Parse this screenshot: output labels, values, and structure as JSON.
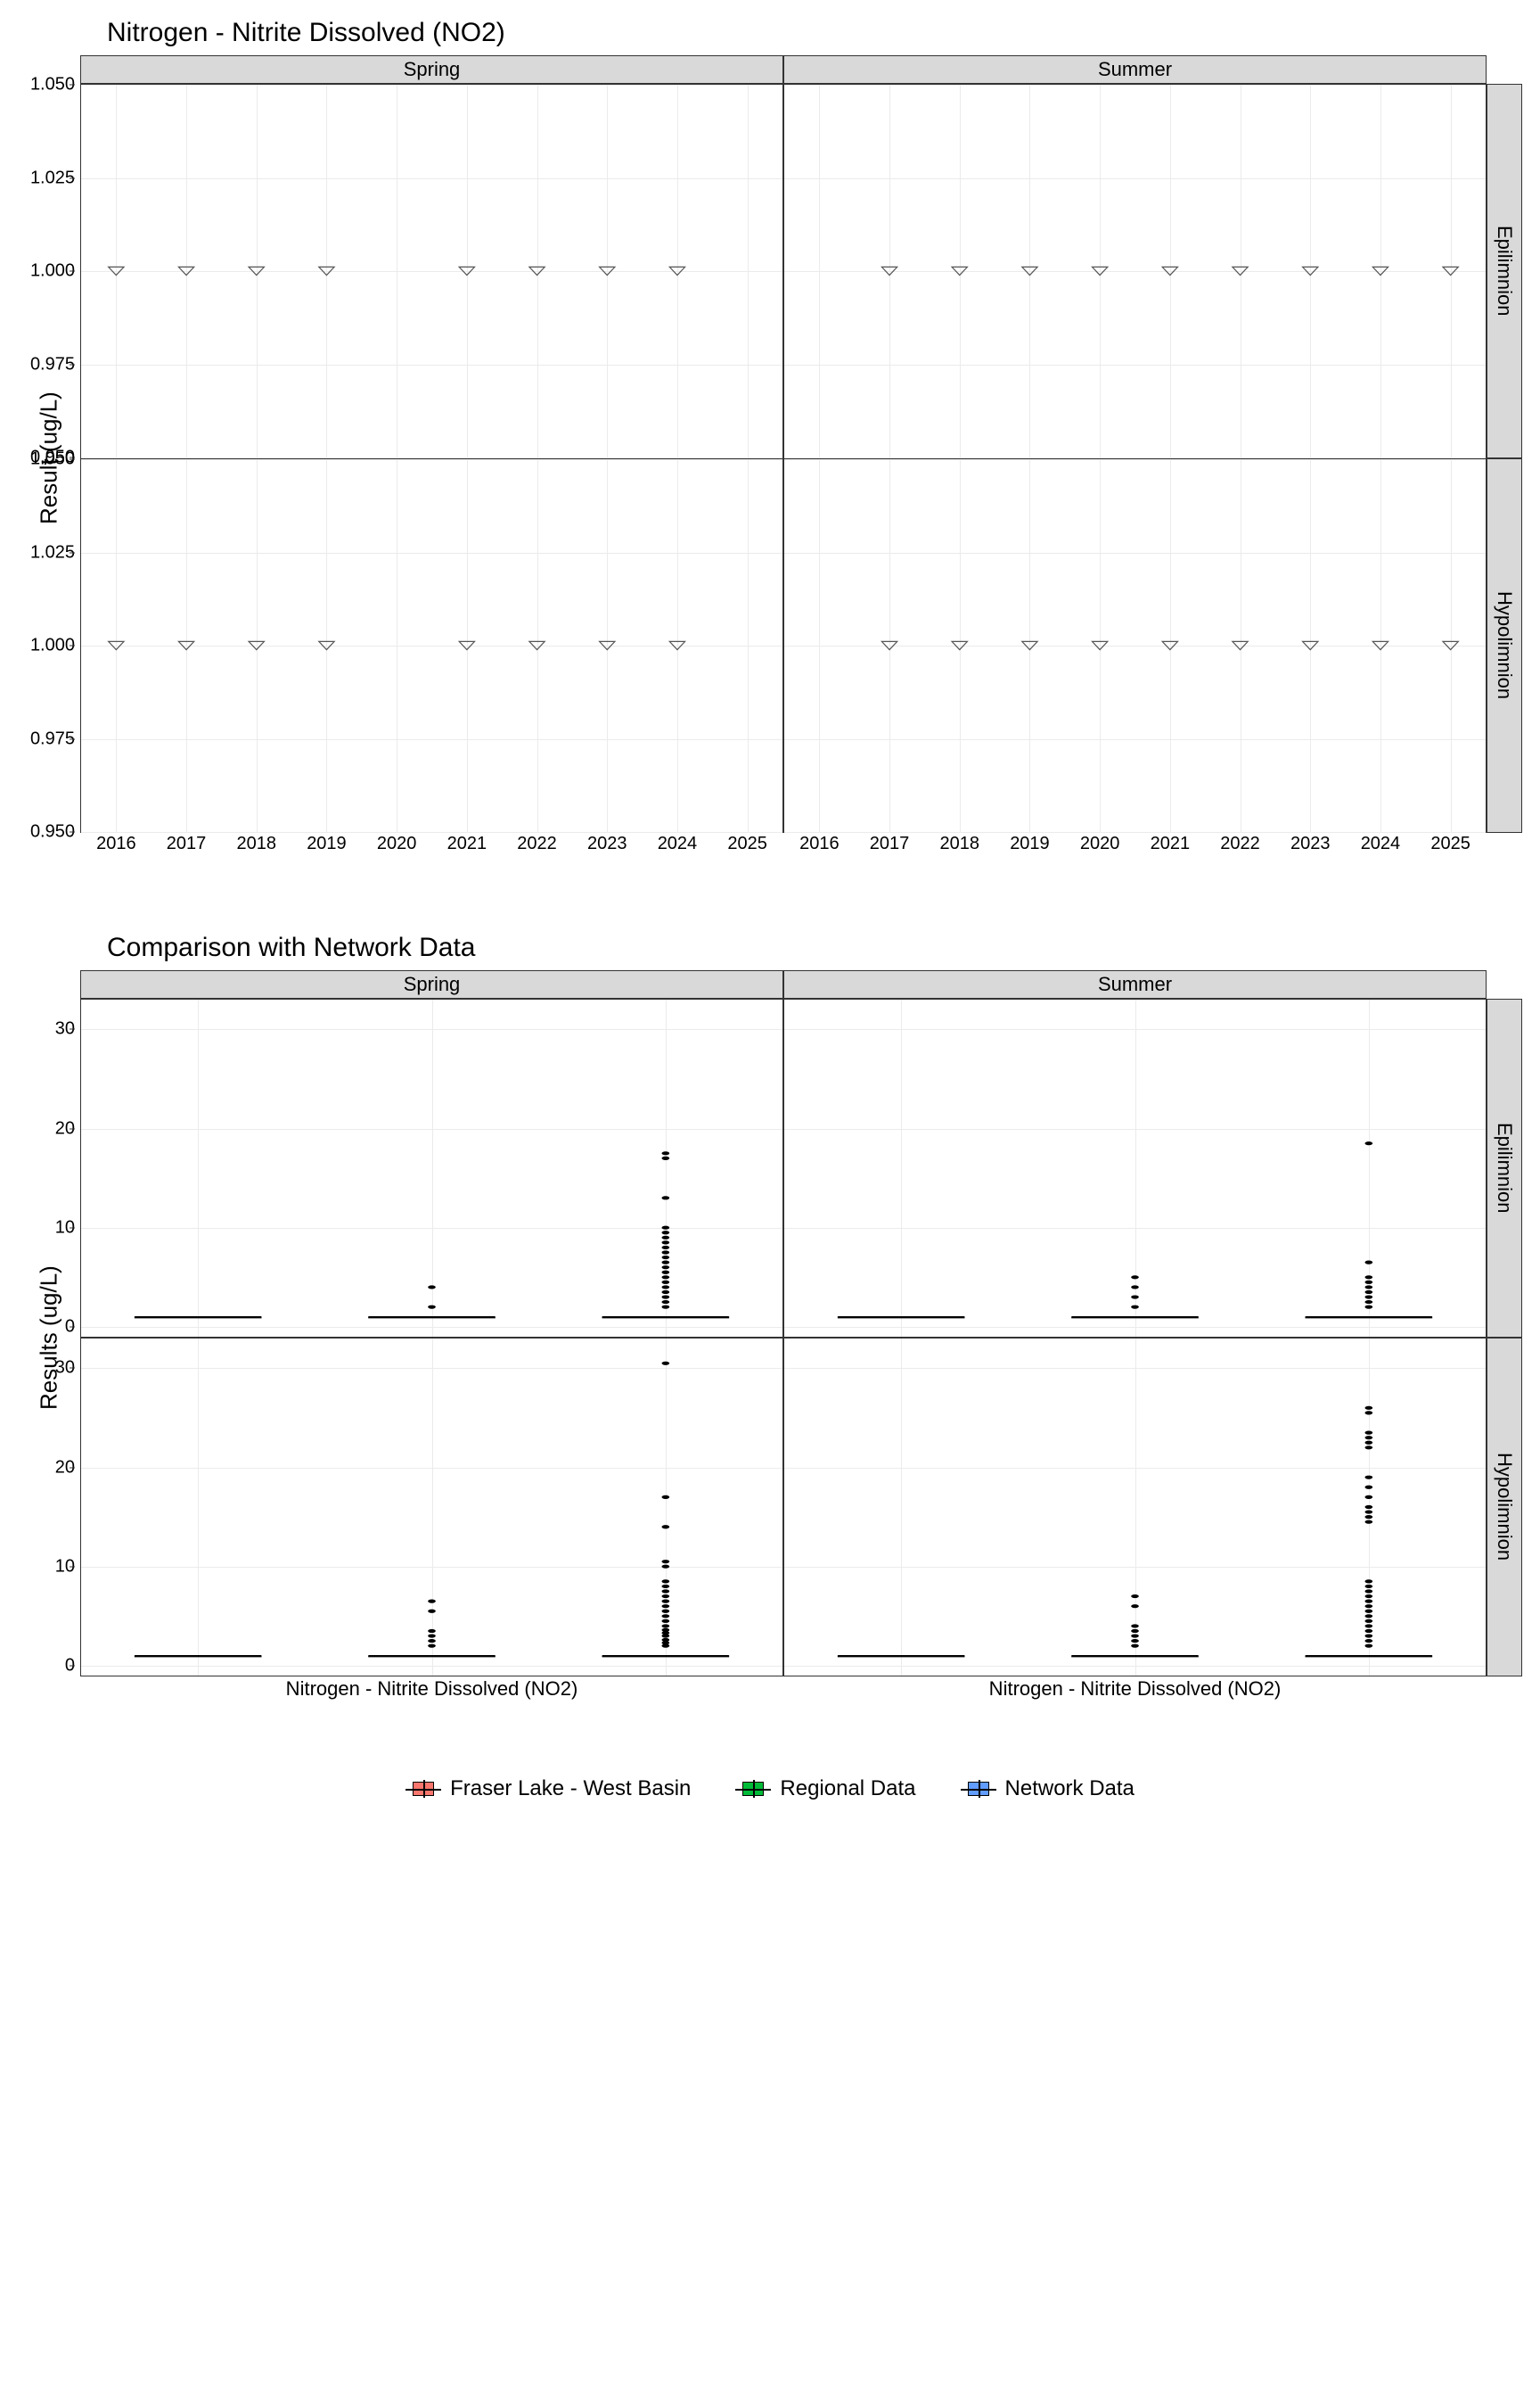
{
  "chart_data": [
    {
      "id": "top",
      "title": "Nitrogen - Nitrite Dissolved (NO2)",
      "ylabel": "Result (ug/L)",
      "xlabel": "",
      "type": "scatter",
      "x_ticks": [
        2016,
        2017,
        2018,
        2019,
        2020,
        2021,
        2022,
        2023,
        2024,
        2025
      ],
      "y_ticks": [
        0.95,
        0.975,
        1.0,
        1.025,
        1.05
      ],
      "ylim": [
        0.95,
        1.05
      ],
      "col_facets": [
        "Spring",
        "Summer"
      ],
      "row_facets": [
        "Epilimnion",
        "Hypolimnion"
      ],
      "marker": "open-triangle-down",
      "panels": {
        "Spring|Epilimnion": {
          "x": [
            2016,
            2017,
            2018,
            2019,
            2021,
            2022,
            2023,
            2024
          ],
          "y": [
            1,
            1,
            1,
            1,
            1,
            1,
            1,
            1
          ]
        },
        "Summer|Epilimnion": {
          "x": [
            2017,
            2018,
            2019,
            2020,
            2021,
            2022,
            2023,
            2024,
            2025
          ],
          "y": [
            1,
            1,
            1,
            1,
            1,
            1,
            1,
            1,
            1
          ]
        },
        "Spring|Hypolimnion": {
          "x": [
            2016,
            2017,
            2018,
            2019,
            2021,
            2022,
            2023,
            2024
          ],
          "y": [
            1,
            1,
            1,
            1,
            1,
            1,
            1,
            1
          ]
        },
        "Summer|Hypolimnion": {
          "x": [
            2017,
            2018,
            2019,
            2020,
            2021,
            2022,
            2023,
            2024,
            2025
          ],
          "y": [
            1,
            1,
            1,
            1,
            1,
            1,
            1,
            1,
            1
          ]
        }
      }
    },
    {
      "id": "bot",
      "title": "Comparison with Network Data",
      "ylabel": "Results (ug/L)",
      "xlabel_per_col": "Nitrogen - Nitrite Dissolved (NO2)",
      "type": "boxplot",
      "y_ticks": [
        0,
        10,
        20,
        30
      ],
      "ylim": [
        -1,
        33
      ],
      "col_facets": [
        "Spring",
        "Summer"
      ],
      "row_facets": [
        "Epilimnion",
        "Hypolimnion"
      ],
      "x_categories": [
        "Fraser Lake - West Basin",
        "Regional Data",
        "Network Data"
      ],
      "series_colors": {
        "Fraser Lake - West Basin": "#F8766D",
        "Regional Data": "#00BA38",
        "Network Data": "#619CFF"
      },
      "panels": {
        "Spring|Epilimnion": {
          "boxes": [
            {
              "min": 1,
              "q1": 1,
              "med": 1,
              "q3": 1,
              "max": 1
            },
            {
              "min": 1,
              "q1": 1,
              "med": 1,
              "q3": 1,
              "max": 1
            },
            {
              "min": 1,
              "q1": 1,
              "med": 1,
              "q3": 1,
              "max": 1
            }
          ],
          "outliers": [
            [],
            [
              2,
              4
            ],
            [
              2,
              2.5,
              3,
              3.5,
              4,
              4.5,
              5,
              5.5,
              6,
              6.5,
              7,
              7.5,
              8,
              8.5,
              9,
              9.5,
              10,
              13,
              17,
              17.5
            ]
          ]
        },
        "Summer|Epilimnion": {
          "boxes": [
            {
              "min": 1,
              "q1": 1,
              "med": 1,
              "q3": 1,
              "max": 1
            },
            {
              "min": 1,
              "q1": 1,
              "med": 1,
              "q3": 1,
              "max": 1
            },
            {
              "min": 1,
              "q1": 1,
              "med": 1,
              "q3": 1,
              "max": 1
            }
          ],
          "outliers": [
            [],
            [
              2,
              3,
              4,
              5
            ],
            [
              2,
              2.5,
              3,
              3.5,
              4,
              4.5,
              5,
              6.5,
              18.5
            ]
          ]
        },
        "Spring|Hypolimnion": {
          "boxes": [
            {
              "min": 1,
              "q1": 1,
              "med": 1,
              "q3": 1,
              "max": 1
            },
            {
              "min": 1,
              "q1": 1,
              "med": 1,
              "q3": 1,
              "max": 1
            },
            {
              "min": 1,
              "q1": 1,
              "med": 1,
              "q3": 1,
              "max": 1
            }
          ],
          "outliers": [
            [],
            [
              2,
              2.5,
              3,
              3.5,
              5.5,
              6.5
            ],
            [
              2,
              2.3,
              2.6,
              3,
              3.3,
              3.6,
              4,
              4.5,
              5,
              5.5,
              6,
              6.5,
              7,
              7.5,
              8,
              8.5,
              10,
              10.5,
              14,
              17,
              30.5
            ]
          ]
        },
        "Summer|Hypolimnion": {
          "boxes": [
            {
              "min": 1,
              "q1": 1,
              "med": 1,
              "q3": 1,
              "max": 1
            },
            {
              "min": 1,
              "q1": 1,
              "med": 1,
              "q3": 1,
              "max": 1
            },
            {
              "min": 1,
              "q1": 1,
              "med": 1,
              "q3": 1,
              "max": 1
            }
          ],
          "outliers": [
            [],
            [
              2,
              2.5,
              3,
              3.5,
              4,
              6,
              7
            ],
            [
              2,
              2.5,
              3,
              3.5,
              4,
              4.5,
              5,
              5.5,
              6,
              6.5,
              7,
              7.5,
              8,
              8.5,
              14.5,
              15,
              15.5,
              16,
              17,
              18,
              19,
              22,
              22.5,
              23,
              23.5,
              25.5,
              26
            ]
          ]
        }
      }
    }
  ],
  "legend": {
    "items": [
      {
        "label": "Fraser Lake - West Basin",
        "color": "#F8766D"
      },
      {
        "label": "Regional Data",
        "color": "#00BA38"
      },
      {
        "label": "Network Data",
        "color": "#619CFF"
      }
    ]
  }
}
